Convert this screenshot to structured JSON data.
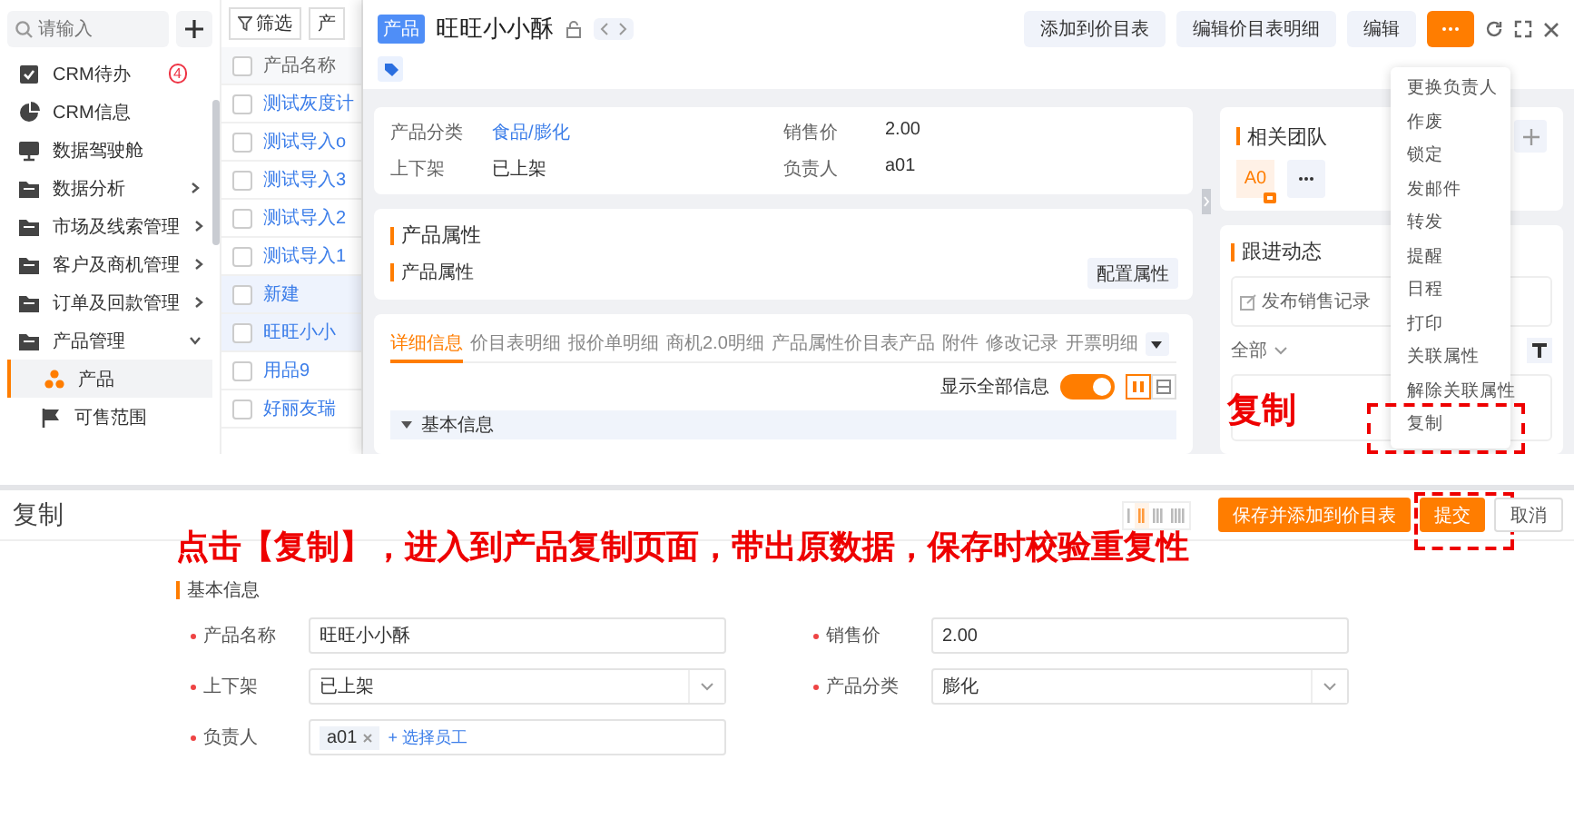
{
  "sidebar": {
    "search": {
      "placeholder": "请输入"
    },
    "items": [
      {
        "label": "CRM待办",
        "kind": "todo",
        "selected": false,
        "badge": "4"
      },
      {
        "label": "CRM信息",
        "kind": "pie",
        "selected": false
      },
      {
        "label": "数据驾驶舱",
        "kind": "screen",
        "selected": false
      },
      {
        "label": "数据分析",
        "kind": "folder",
        "selected": false,
        "expanded": false
      },
      {
        "label": "市场及线索管理",
        "kind": "folder",
        "selected": false,
        "expanded": false
      },
      {
        "label": "客户及商机管理",
        "kind": "folder",
        "selected": false,
        "expanded": false
      },
      {
        "label": "订单及回款管理",
        "kind": "folder",
        "selected": false,
        "expanded": false
      },
      {
        "label": "产品管理",
        "kind": "folder",
        "selected": false,
        "expanded": true,
        "children": [
          {
            "label": "产品",
            "kind": "product",
            "selected": true
          },
          {
            "label": "可售范围",
            "kind": "flag",
            "selected": false
          }
        ]
      }
    ]
  },
  "list": {
    "toolbar": [
      "筛选",
      "产"
    ],
    "header": {
      "label": "产品名称",
      "checked": false
    },
    "rows": [
      {
        "name": "测试灰度计",
        "selected": false,
        "checked": false
      },
      {
        "name": "测试导入o",
        "selected": false,
        "checked": false
      },
      {
        "name": "测试导入3",
        "selected": false,
        "checked": false
      },
      {
        "name": "测试导入2",
        "selected": false,
        "checked": false
      },
      {
        "name": "测试导入1",
        "selected": false,
        "checked": false
      },
      {
        "name": "新建",
        "selected": true,
        "checked": false
      },
      {
        "name": "旺旺小小",
        "selected": true,
        "checked": false
      },
      {
        "name": "用品9",
        "selected": false,
        "checked": false
      },
      {
        "name": "好丽友瑞",
        "selected": false,
        "checked": false
      }
    ]
  },
  "detail": {
    "tag": "产品",
    "title": "旺旺小小酥",
    "actions": [
      "添加到价目表",
      "编辑价目表明细",
      "编辑"
    ],
    "info": [
      {
        "label": "产品分类",
        "value": "食品/膨化",
        "link": true
      },
      {
        "label": "销售价",
        "value": "2.00",
        "link": false
      },
      {
        "label": "上下架",
        "value": "已上架",
        "link": false
      },
      {
        "label": "负责人",
        "value": "a01",
        "link": false
      }
    ],
    "attributes": {
      "title": "产品属性",
      "subtitle": "产品属性",
      "button": "配置属性"
    },
    "tabs": [
      {
        "label": "详细信息",
        "selected": true
      },
      {
        "label": "价目表明细",
        "selected": false
      },
      {
        "label": "报价单明细",
        "selected": false
      },
      {
        "label": "商机2.0明细",
        "selected": false
      },
      {
        "label": "产品属性价目表产品",
        "selected": false
      },
      {
        "label": "附件",
        "selected": false
      },
      {
        "label": "修改记录",
        "selected": false
      },
      {
        "label": "开票明细",
        "selected": false
      }
    ],
    "show_all": {
      "label": "显示全部信息",
      "on": true
    },
    "layout_buttons": [
      {
        "selected": true
      },
      {
        "selected": false
      }
    ],
    "section": "基本信息",
    "team": {
      "title": "相关团队",
      "members": [
        "A0"
      ]
    },
    "follow": {
      "title": "跟进动态",
      "post": "发布销售记录",
      "filter": "全部"
    },
    "menu": [
      {
        "label": "更换负责人",
        "highlighted": false
      },
      {
        "label": "作废",
        "highlighted": false
      },
      {
        "label": "锁定",
        "highlighted": false
      },
      {
        "label": "发邮件",
        "highlighted": false
      },
      {
        "label": "转发",
        "highlighted": false
      },
      {
        "label": "提醒",
        "highlighted": false
      },
      {
        "label": "日程",
        "highlighted": false
      },
      {
        "label": "打印",
        "highlighted": false
      },
      {
        "label": "关联属性",
        "highlighted": false
      },
      {
        "label": "解除关联属性",
        "highlighted": false
      },
      {
        "label": "复制",
        "highlighted": true
      }
    ],
    "menu_note": "复制"
  },
  "copy_page": {
    "title": "复制",
    "note": "点击【复制】，进入到产品复制页面，带出原数据，保存时校验重复性",
    "view_modes": [
      {
        "selected": false
      },
      {
        "selected": true
      },
      {
        "selected": false
      },
      {
        "selected": false
      }
    ],
    "buttons": [
      {
        "label": "保存并添加到价目表",
        "kind": "primary",
        "highlighted": false
      },
      {
        "label": "提交",
        "kind": "primary",
        "highlighted": true
      },
      {
        "label": "取消",
        "kind": "plain",
        "highlighted": false
      }
    ],
    "section": "基本信息",
    "fields": [
      {
        "label": "产品名称",
        "kind": "text",
        "value": "旺旺小小酥",
        "required": true
      },
      {
        "label": "销售价",
        "kind": "text",
        "value": "2.00",
        "required": true
      },
      {
        "label": "上下架",
        "kind": "select",
        "value": "已上架",
        "required": true
      },
      {
        "label": "产品分类",
        "kind": "select",
        "value": "膨化",
        "required": true
      },
      {
        "label": "负责人",
        "kind": "people",
        "tags": [
          "a01"
        ],
        "add": "+ 选择员工",
        "required": true
      }
    ]
  }
}
